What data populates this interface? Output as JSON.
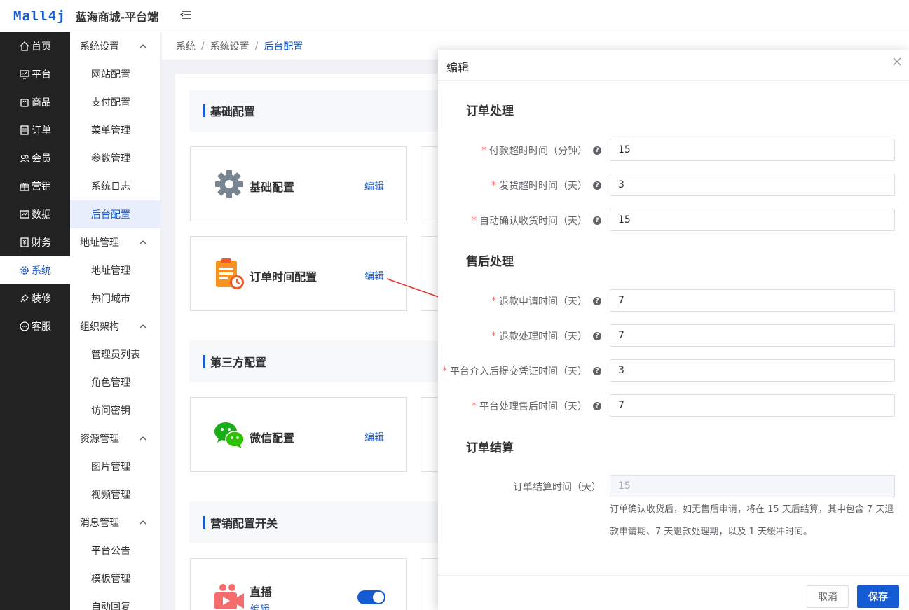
{
  "header": {
    "logo": "Mall4j",
    "title": "蓝海商城-平台端"
  },
  "main_nav": [
    {
      "label": "首页",
      "icon": "home-icon"
    },
    {
      "label": "平台",
      "icon": "monitor-icon"
    },
    {
      "label": "商品",
      "icon": "bag-icon"
    },
    {
      "label": "订单",
      "icon": "document-icon"
    },
    {
      "label": "会员",
      "icon": "users-icon"
    },
    {
      "label": "营销",
      "icon": "gift-icon"
    },
    {
      "label": "数据",
      "icon": "chart-icon"
    },
    {
      "label": "财务",
      "icon": "finance-icon"
    },
    {
      "label": "系统",
      "icon": "gear-icon",
      "active": true
    },
    {
      "label": "装修",
      "icon": "brush-icon"
    },
    {
      "label": "客服",
      "icon": "chat-icon"
    }
  ],
  "sub_nav": [
    {
      "type": "group",
      "label": "系统设置"
    },
    {
      "type": "item",
      "label": "网站配置"
    },
    {
      "type": "item",
      "label": "支付配置"
    },
    {
      "type": "item",
      "label": "菜单管理"
    },
    {
      "type": "item",
      "label": "参数管理"
    },
    {
      "type": "item",
      "label": "系统日志"
    },
    {
      "type": "item",
      "label": "后台配置",
      "active": true
    },
    {
      "type": "group",
      "label": "地址管理"
    },
    {
      "type": "item",
      "label": "地址管理"
    },
    {
      "type": "item",
      "label": "热门城市"
    },
    {
      "type": "group",
      "label": "组织架构"
    },
    {
      "type": "item",
      "label": "管理员列表"
    },
    {
      "type": "item",
      "label": "角色管理"
    },
    {
      "type": "item",
      "label": "访问密钥"
    },
    {
      "type": "group",
      "label": "资源管理"
    },
    {
      "type": "item",
      "label": "图片管理"
    },
    {
      "type": "item",
      "label": "视频管理"
    },
    {
      "type": "group",
      "label": "消息管理"
    },
    {
      "type": "item",
      "label": "平台公告"
    },
    {
      "type": "item",
      "label": "模板管理"
    },
    {
      "type": "item",
      "label": "自动回复"
    }
  ],
  "breadcrumb": [
    "系统",
    "系统设置",
    "后台配置"
  ],
  "sections": {
    "basic": "基础配置",
    "third_party": "第三方配置",
    "marketing": "营销配置开关"
  },
  "cards": {
    "basic_config": {
      "name": "基础配置",
      "edit": "编辑"
    },
    "order_time": {
      "name": "订单时间配置",
      "edit": "编辑"
    },
    "wechat": {
      "name": "微信配置",
      "edit": "编辑"
    },
    "live": {
      "name": "直播",
      "edit": "编辑",
      "enabled": true
    }
  },
  "drawer": {
    "title": "编辑",
    "groups": {
      "order_process": "订单处理",
      "after_sale": "售后处理",
      "settlement": "订单结算"
    },
    "fields": {
      "pay_timeout": {
        "label": "付款超时时间（分钟）",
        "value": "15"
      },
      "ship_timeout": {
        "label": "发货超时时间（天）",
        "value": "3"
      },
      "auto_confirm": {
        "label": "自动确认收货时间（天）",
        "value": "15"
      },
      "refund_apply": {
        "label": "退款申请时间（天）",
        "value": "7"
      },
      "refund_process": {
        "label": "退款处理时间（天）",
        "value": "7"
      },
      "platform_evidence": {
        "label": "平台介入后提交凭证时间（天）",
        "value": "3"
      },
      "platform_aftersale": {
        "label": "平台处理售后时间（天）",
        "value": "7"
      },
      "settlement_time": {
        "label": "订单结算时间（天）",
        "value": "15"
      }
    },
    "tip": "订单确认收货后，如无售后申请，将在 15 天后结算，其中包含 7 天退款申请期、7 天退款处理期，以及 1 天缓冲时间。",
    "buttons": {
      "cancel": "取消",
      "save": "保存"
    }
  },
  "colors": {
    "accent": "#155bd4",
    "sidebar": "#222222",
    "required": "#f56c6c"
  }
}
